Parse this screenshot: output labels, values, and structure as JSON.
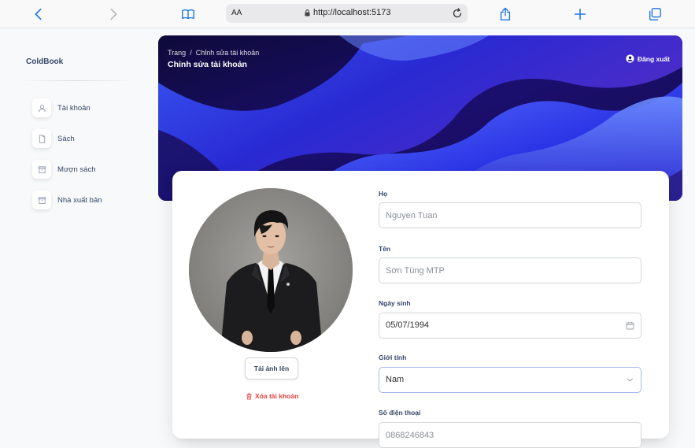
{
  "browser": {
    "aa_label": "AA",
    "url": "http://localhost:5173"
  },
  "sidebar": {
    "brand": "ColdBook",
    "items": [
      {
        "label": "Tài khoản",
        "icon": "user-icon"
      },
      {
        "label": "Sách",
        "icon": "document-icon"
      },
      {
        "label": "Mượn sách",
        "icon": "box-icon"
      },
      {
        "label": "Nhà xuất bản",
        "icon": "box-icon"
      }
    ]
  },
  "header": {
    "breadcrumb_root": "Trang",
    "breadcrumb_sep": "/",
    "breadcrumb_current": "Chỉnh sửa tài khoản",
    "title": "Chỉnh sửa tài khoản",
    "logout_label": "Đăng xuất"
  },
  "profile": {
    "upload_label": "Tải ảnh lên",
    "delete_label": "Xóa tài khoản"
  },
  "form": {
    "ho": {
      "label": "Họ",
      "placeholder": "Nguyen Tuan"
    },
    "ten": {
      "label": "Tên",
      "placeholder": "Sơn Tùng MTP"
    },
    "ngay_sinh": {
      "label": "Ngày sinh",
      "value": "05/07/1994"
    },
    "gioi_tinh": {
      "label": "Giới tính",
      "value": "Nam"
    },
    "so_dien_thoai": {
      "label": "Số điện thoại",
      "placeholder": "0868246843"
    }
  },
  "colors": {
    "banner_dark": "#1a0a5e",
    "banner_blue": "#2d3bd8",
    "danger": "#e83e3e",
    "text": "#344767"
  }
}
